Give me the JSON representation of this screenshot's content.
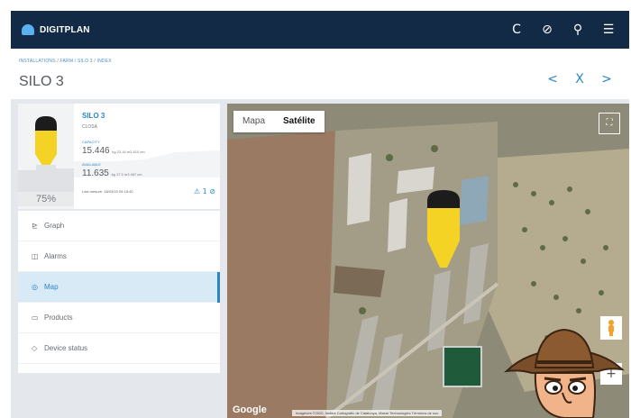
{
  "app": {
    "brand": "DIGITPLAN"
  },
  "topbar": {
    "icons": [
      "refresh-icon",
      "compass-icon",
      "search-icon",
      "menu-list-icon"
    ],
    "glyphs": [
      "C",
      "⊘",
      "⚲",
      "☰"
    ]
  },
  "header": {
    "breadcrumb": "INSTALLATIONS / FARM / SILO 3 / INDEX",
    "title": "SILO 3",
    "nav": [
      "<",
      "X",
      ">"
    ]
  },
  "silo": {
    "name": "SILO 3",
    "product": "CLOSA",
    "fill_percent": "75%",
    "fill_fraction": 0.75,
    "capacity_label": "CAPACITY",
    "capacity_value": "15.446",
    "capacity_unit": "kg 23.16 m3 610 cm",
    "available_label": "AVAILABLE",
    "available_value": "11.635",
    "available_unit": "kg 17.9 m3 467 cm",
    "last_reading": "Last mesure: 18/03/20 09:18:40",
    "status": "⚠ 1 ⊘"
  },
  "menu": {
    "items": [
      {
        "label": "Graph",
        "icon": "chart-icon",
        "glyph": "⊵",
        "active": false
      },
      {
        "label": "Alarms",
        "icon": "alarm-icon",
        "glyph": "◫",
        "active": false
      },
      {
        "label": "Map",
        "icon": "map-pin-icon",
        "glyph": "◎",
        "active": true
      },
      {
        "label": "Products",
        "icon": "folder-icon",
        "glyph": "▭",
        "active": false
      },
      {
        "label": "Device status",
        "icon": "shield-icon",
        "glyph": "◇",
        "active": false
      }
    ]
  },
  "map": {
    "mode_map": "Mapa",
    "mode_satellite": "Satélite",
    "selected_mode": "Satélite",
    "fullscreen_glyph": "⛶",
    "zoom_in": "+",
    "google": "Google",
    "attribution": "Imágenes ©2020, Institut Cartogràfic de Catalunya, Maxar Technologies  Términos de uso"
  },
  "colors": {
    "navy": "#122a45",
    "accent": "#2a86c8",
    "silo_yellow": "#f5d324",
    "silo_black": "#1c1c1c"
  }
}
